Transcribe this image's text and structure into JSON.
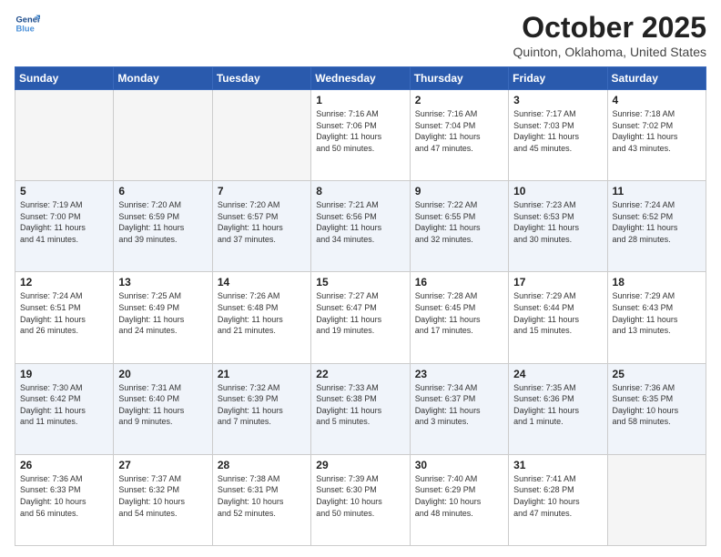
{
  "header": {
    "logo_line1": "General",
    "logo_line2": "Blue",
    "month": "October 2025",
    "location": "Quinton, Oklahoma, United States"
  },
  "weekdays": [
    "Sunday",
    "Monday",
    "Tuesday",
    "Wednesday",
    "Thursday",
    "Friday",
    "Saturday"
  ],
  "weeks": [
    [
      {
        "day": "",
        "empty": true
      },
      {
        "day": "",
        "empty": true
      },
      {
        "day": "",
        "empty": true
      },
      {
        "day": "1",
        "lines": [
          "Sunrise: 7:16 AM",
          "Sunset: 7:06 PM",
          "Daylight: 11 hours",
          "and 50 minutes."
        ]
      },
      {
        "day": "2",
        "lines": [
          "Sunrise: 7:16 AM",
          "Sunset: 7:04 PM",
          "Daylight: 11 hours",
          "and 47 minutes."
        ]
      },
      {
        "day": "3",
        "lines": [
          "Sunrise: 7:17 AM",
          "Sunset: 7:03 PM",
          "Daylight: 11 hours",
          "and 45 minutes."
        ]
      },
      {
        "day": "4",
        "lines": [
          "Sunrise: 7:18 AM",
          "Sunset: 7:02 PM",
          "Daylight: 11 hours",
          "and 43 minutes."
        ]
      }
    ],
    [
      {
        "day": "5",
        "lines": [
          "Sunrise: 7:19 AM",
          "Sunset: 7:00 PM",
          "Daylight: 11 hours",
          "and 41 minutes."
        ]
      },
      {
        "day": "6",
        "lines": [
          "Sunrise: 7:20 AM",
          "Sunset: 6:59 PM",
          "Daylight: 11 hours",
          "and 39 minutes."
        ]
      },
      {
        "day": "7",
        "lines": [
          "Sunrise: 7:20 AM",
          "Sunset: 6:57 PM",
          "Daylight: 11 hours",
          "and 37 minutes."
        ]
      },
      {
        "day": "8",
        "lines": [
          "Sunrise: 7:21 AM",
          "Sunset: 6:56 PM",
          "Daylight: 11 hours",
          "and 34 minutes."
        ]
      },
      {
        "day": "9",
        "lines": [
          "Sunrise: 7:22 AM",
          "Sunset: 6:55 PM",
          "Daylight: 11 hours",
          "and 32 minutes."
        ]
      },
      {
        "day": "10",
        "lines": [
          "Sunrise: 7:23 AM",
          "Sunset: 6:53 PM",
          "Daylight: 11 hours",
          "and 30 minutes."
        ]
      },
      {
        "day": "11",
        "lines": [
          "Sunrise: 7:24 AM",
          "Sunset: 6:52 PM",
          "Daylight: 11 hours",
          "and 28 minutes."
        ]
      }
    ],
    [
      {
        "day": "12",
        "lines": [
          "Sunrise: 7:24 AM",
          "Sunset: 6:51 PM",
          "Daylight: 11 hours",
          "and 26 minutes."
        ]
      },
      {
        "day": "13",
        "lines": [
          "Sunrise: 7:25 AM",
          "Sunset: 6:49 PM",
          "Daylight: 11 hours",
          "and 24 minutes."
        ]
      },
      {
        "day": "14",
        "lines": [
          "Sunrise: 7:26 AM",
          "Sunset: 6:48 PM",
          "Daylight: 11 hours",
          "and 21 minutes."
        ]
      },
      {
        "day": "15",
        "lines": [
          "Sunrise: 7:27 AM",
          "Sunset: 6:47 PM",
          "Daylight: 11 hours",
          "and 19 minutes."
        ]
      },
      {
        "day": "16",
        "lines": [
          "Sunrise: 7:28 AM",
          "Sunset: 6:45 PM",
          "Daylight: 11 hours",
          "and 17 minutes."
        ]
      },
      {
        "day": "17",
        "lines": [
          "Sunrise: 7:29 AM",
          "Sunset: 6:44 PM",
          "Daylight: 11 hours",
          "and 15 minutes."
        ]
      },
      {
        "day": "18",
        "lines": [
          "Sunrise: 7:29 AM",
          "Sunset: 6:43 PM",
          "Daylight: 11 hours",
          "and 13 minutes."
        ]
      }
    ],
    [
      {
        "day": "19",
        "lines": [
          "Sunrise: 7:30 AM",
          "Sunset: 6:42 PM",
          "Daylight: 11 hours",
          "and 11 minutes."
        ]
      },
      {
        "day": "20",
        "lines": [
          "Sunrise: 7:31 AM",
          "Sunset: 6:40 PM",
          "Daylight: 11 hours",
          "and 9 minutes."
        ]
      },
      {
        "day": "21",
        "lines": [
          "Sunrise: 7:32 AM",
          "Sunset: 6:39 PM",
          "Daylight: 11 hours",
          "and 7 minutes."
        ]
      },
      {
        "day": "22",
        "lines": [
          "Sunrise: 7:33 AM",
          "Sunset: 6:38 PM",
          "Daylight: 11 hours",
          "and 5 minutes."
        ]
      },
      {
        "day": "23",
        "lines": [
          "Sunrise: 7:34 AM",
          "Sunset: 6:37 PM",
          "Daylight: 11 hours",
          "and 3 minutes."
        ]
      },
      {
        "day": "24",
        "lines": [
          "Sunrise: 7:35 AM",
          "Sunset: 6:36 PM",
          "Daylight: 11 hours",
          "and 1 minute."
        ]
      },
      {
        "day": "25",
        "lines": [
          "Sunrise: 7:36 AM",
          "Sunset: 6:35 PM",
          "Daylight: 10 hours",
          "and 58 minutes."
        ]
      }
    ],
    [
      {
        "day": "26",
        "lines": [
          "Sunrise: 7:36 AM",
          "Sunset: 6:33 PM",
          "Daylight: 10 hours",
          "and 56 minutes."
        ]
      },
      {
        "day": "27",
        "lines": [
          "Sunrise: 7:37 AM",
          "Sunset: 6:32 PM",
          "Daylight: 10 hours",
          "and 54 minutes."
        ]
      },
      {
        "day": "28",
        "lines": [
          "Sunrise: 7:38 AM",
          "Sunset: 6:31 PM",
          "Daylight: 10 hours",
          "and 52 minutes."
        ]
      },
      {
        "day": "29",
        "lines": [
          "Sunrise: 7:39 AM",
          "Sunset: 6:30 PM",
          "Daylight: 10 hours",
          "and 50 minutes."
        ]
      },
      {
        "day": "30",
        "lines": [
          "Sunrise: 7:40 AM",
          "Sunset: 6:29 PM",
          "Daylight: 10 hours",
          "and 48 minutes."
        ]
      },
      {
        "day": "31",
        "lines": [
          "Sunrise: 7:41 AM",
          "Sunset: 6:28 PM",
          "Daylight: 10 hours",
          "and 47 minutes."
        ]
      },
      {
        "day": "",
        "empty": true
      }
    ]
  ]
}
